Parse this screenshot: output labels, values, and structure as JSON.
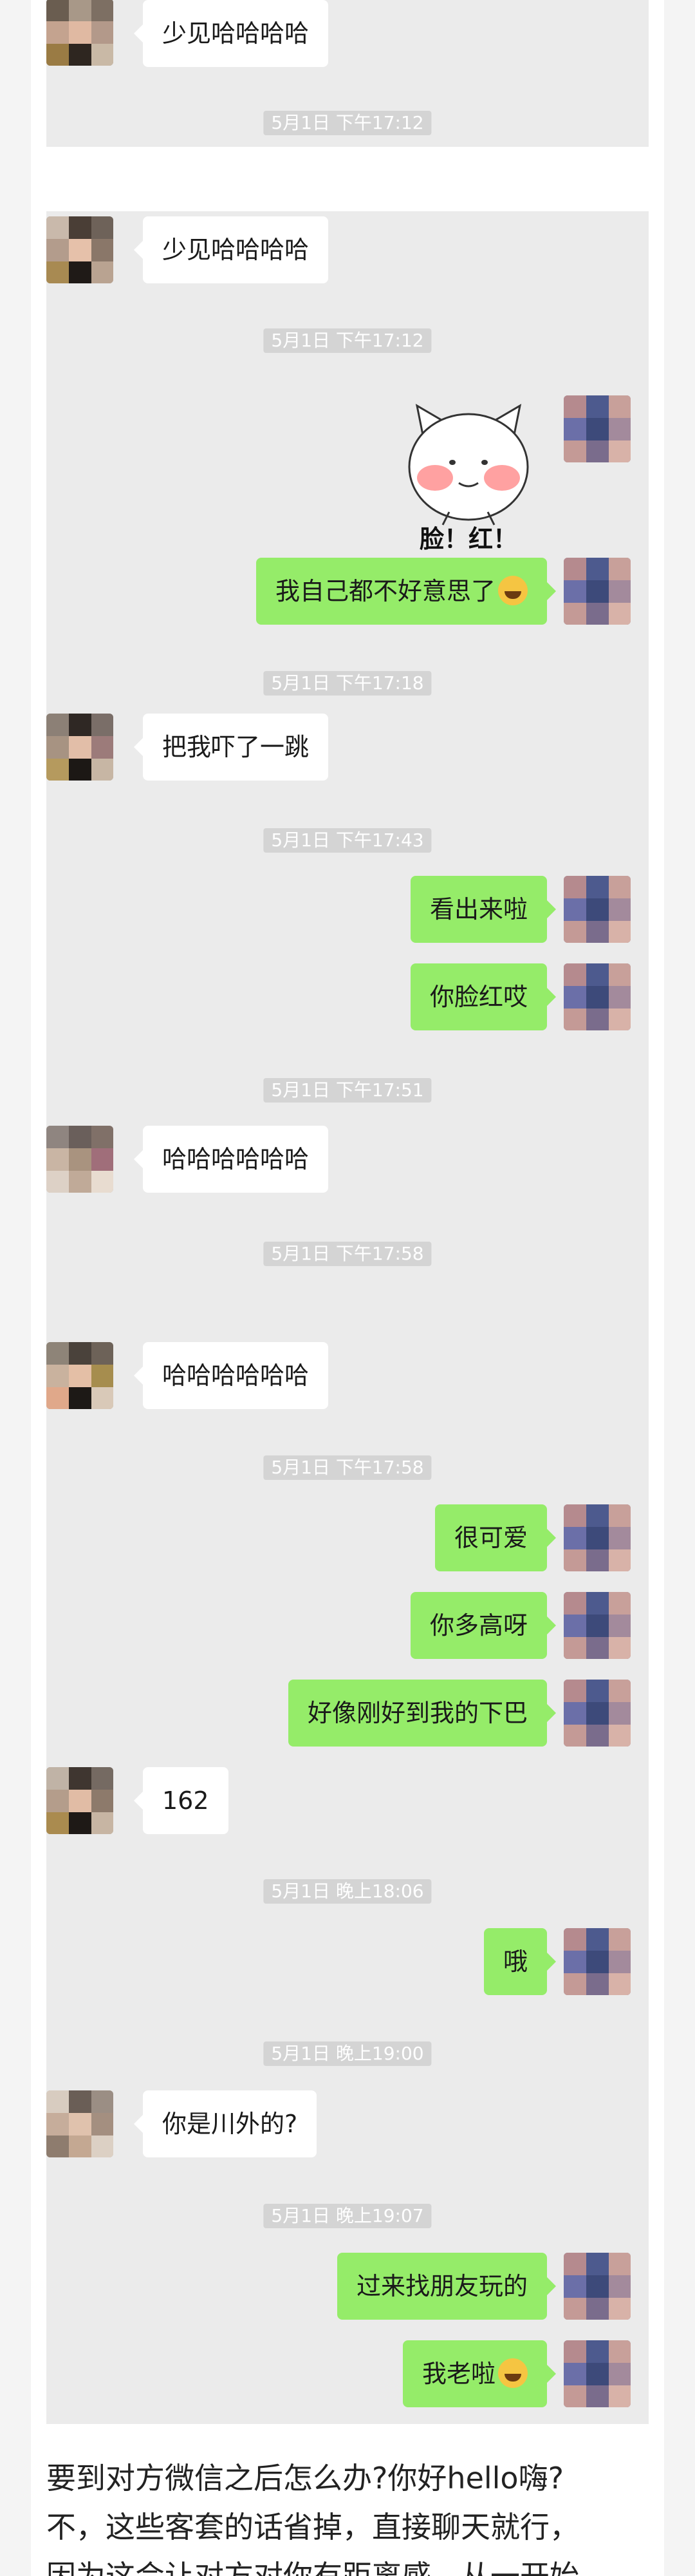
{
  "colors": {
    "page_bg": "#f4f4f4",
    "chat_bg": "#ebebeb",
    "incoming_bubble": "#ffffff",
    "outgoing_bubble": "#95ec69",
    "timestamp_bg": "#d4d4d4"
  },
  "screenshot1": {
    "messages": [
      "少见哈哈哈哈"
    ],
    "timestamps": [
      "5月1日 下午17:12"
    ]
  },
  "screenshot2": {
    "messages": {
      "m1": "少见哈哈哈哈",
      "m3": "我自己都不好意思了",
      "m4": "把我吓了一跳",
      "m5": "看出来啦",
      "m6": "你脸红哎",
      "m7": "哈哈哈哈哈哈"
    },
    "sticker_text": "脸！红！",
    "timestamps": {
      "t1": "5月1日 下午17:12",
      "t2": "5月1日 下午17:18",
      "t3": "5月1日 下午17:43",
      "t4": "5月1日 下午17:51",
      "t5": "5月1日 下午17:58"
    }
  },
  "screenshot3": {
    "messages": {
      "m1": "哈哈哈哈哈哈",
      "m2": "很可爱",
      "m3": "你多高呀",
      "m4": "好像刚好到我的下巴",
      "m5": "162",
      "m6": "哦",
      "m7": "你是川外的?",
      "m8": "过来找朋友玩的",
      "m9": "我老啦"
    },
    "timestamps": {
      "t1": "5月1日 下午17:58",
      "t2": "5月1日 晚上18:06",
      "t3": "5月1日 晚上19:00",
      "t4": "5月1日 晚上19:07"
    }
  },
  "article": {
    "line1": "要到对方微信之后怎么办?你好hello嗨?",
    "line2": "不，这些客套的话省掉，直接聊天就行，",
    "line3": "因为这会让对方对你有距离感，从一开始"
  }
}
